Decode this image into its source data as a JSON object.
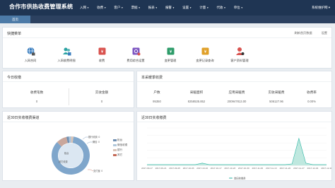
{
  "app": {
    "title": "合作市供热收费管理系统",
    "user_label": "系统维护网 ▾"
  },
  "nav": [
    {
      "label": "入网"
    },
    {
      "label": "收费"
    },
    {
      "label": "客户"
    },
    {
      "label": "票据"
    },
    {
      "label": "报表"
    },
    {
      "label": "报警"
    },
    {
      "label": "设置"
    },
    {
      "label": "计量"
    },
    {
      "label": "代收"
    },
    {
      "label": "单位"
    }
  ],
  "tabs": {
    "home": "首页"
  },
  "quick": {
    "title": "快捷菜单",
    "refresh": "刷新首页数据",
    "settings": "设置",
    "items": [
      {
        "label": "入网合同",
        "icon": "network-contract-icon",
        "color": "#3a7ebf"
      },
      {
        "label": "入网收费明细",
        "icon": "users-detail-icon",
        "color": "#2ba3a3"
      },
      {
        "label": "收费",
        "icon": "charge-icon",
        "color": "#d9534f"
      },
      {
        "label": "费用综合设置",
        "icon": "fee-settings-icon",
        "color": "#7e57c2"
      },
      {
        "label": "变更管理",
        "icon": "change-manage-icon",
        "color": "#2e9c6a"
      },
      {
        "label": "变更记录查询",
        "icon": "change-log-icon",
        "color": "#e0a029"
      },
      {
        "label": "客户资料管理",
        "icon": "customer-manage-icon",
        "color": "#d9534f"
      }
    ]
  },
  "today": {
    "title": "今日收缴",
    "count_label": "收费笔数",
    "count_value": "0",
    "amount_label": "实收金额",
    "amount_value": "0"
  },
  "season": {
    "title": "本采暖季收费",
    "columns": [
      "户数",
      "采暖面积",
      "应用采暖费",
      "实收采暖费",
      "收费率"
    ],
    "values": [
      "95350",
      "8258535.852",
      "200947813.00",
      "506127.96",
      "0.00%"
    ]
  },
  "channel": {
    "title": "近30日实收缴费渠道",
    "callouts": [
      "银行收费: 0",
      "微信: 0",
      "柜台",
      "其它收费",
      "支付宝: 0"
    ],
    "legend": [
      {
        "label": "柜台",
        "color": "#6f8fb1"
      },
      {
        "label": "微信收费",
        "color": "#b1c8db"
      },
      {
        "label": "银行",
        "color": "#d8c3b6"
      },
      {
        "label": "其它",
        "color": "#c46a57"
      }
    ]
  },
  "trend": {
    "title": "近30日实收缴费"
  },
  "chart_data": [
    {
      "type": "pie",
      "title": "近30日实收缴费渠道",
      "categories": [
        "柜台",
        "其它收费",
        "银行收费",
        "微信",
        "支付宝"
      ],
      "values": [
        85,
        9,
        2,
        2,
        2
      ]
    },
    {
      "type": "area",
      "title": "近30日实收缴费",
      "categories": [
        "2017-09-17",
        "2017-09-21",
        "2017-09-25",
        "2017-09-29",
        "2017-10-03",
        "2017-10-06",
        "2017-10-10",
        "2017-10-13",
        "2017-10-17",
        "2017-10-20",
        "2017-10-23",
        "2017-10-26",
        "2017-10-30",
        "2017-11-02",
        "2017-11-05",
        "2017-11-09",
        "2017-11-12",
        "2017-11-16",
        "2017-11-19",
        "2017-11-23",
        "2017-11-26",
        "2017-11-29",
        "2017-12-03",
        "2017-12-06",
        "2017-12-10",
        "2017-12-13",
        "2017-12-17"
      ],
      "tick_labels": [
        "2017-09-17",
        "2017-09-21",
        "2017-09-25",
        "2017-10-03",
        "2017-10-10",
        "2017-10-17",
        "2017-10-23",
        "2017-10-30",
        "2017-11-06",
        "2017-11-13",
        "2017-11-20",
        "2017-11-27",
        "2017-12-04",
        "2017-12-11"
      ],
      "series": [
        {
          "name": "金田收缴费",
          "values": [
            1,
            1,
            1,
            1,
            1,
            1,
            1,
            1,
            3,
            1,
            1,
            1,
            1,
            1,
            1,
            1,
            1,
            1,
            1,
            1,
            1,
            2,
            36,
            3,
            1,
            1,
            1
          ]
        }
      ],
      "ylim": [
        0,
        50
      ],
      "grid": true,
      "legend": "bottom"
    }
  ]
}
